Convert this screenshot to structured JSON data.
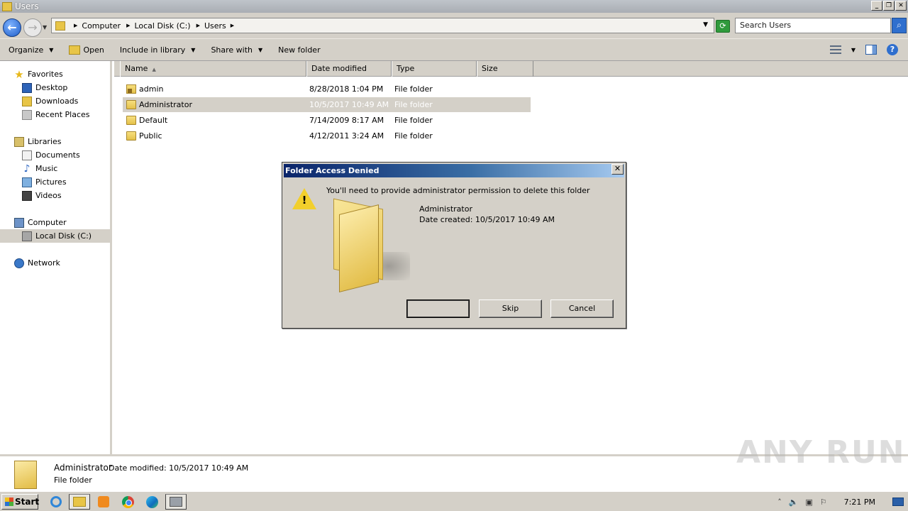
{
  "window": {
    "title": "Users"
  },
  "address": {
    "crumbs": [
      "Computer",
      "Local Disk (C:)",
      "Users"
    ],
    "search_placeholder": "Search Users"
  },
  "toolbar": {
    "organize": "Organize",
    "open": "Open",
    "include": "Include in library",
    "share": "Share with",
    "new_folder": "New folder"
  },
  "nav": {
    "favorites": "Favorites",
    "desktop": "Desktop",
    "downloads": "Downloads",
    "recent": "Recent Places",
    "libraries": "Libraries",
    "documents": "Documents",
    "music": "Music",
    "pictures": "Pictures",
    "videos": "Videos",
    "computer": "Computer",
    "local_disk": "Local Disk (C:)",
    "network": "Network"
  },
  "columns": {
    "name": "Name",
    "date": "Date modified",
    "type": "Type",
    "size": "Size"
  },
  "files": [
    {
      "name": "admin",
      "date": "8/28/2018 1:04 PM",
      "type": "File folder",
      "locked": true
    },
    {
      "name": "Administrator",
      "date": "10/5/2017 10:49 AM",
      "type": "File folder",
      "selected": true
    },
    {
      "name": "Default",
      "date": "7/14/2009 8:17 AM",
      "type": "File folder"
    },
    {
      "name": "Public",
      "date": "4/12/2011 3:24 AM",
      "type": "File folder"
    }
  ],
  "dialog": {
    "title": "Folder Access Denied",
    "close": "✕",
    "message": "You'll need to provide administrator permission to delete this folder",
    "folder_name": "Administrator",
    "date_created": "Date created: 10/5/2017 10:49 AM",
    "continue_label": "",
    "skip_label": "Skip",
    "cancel_label": "Cancel"
  },
  "details": {
    "name": "Administrator",
    "modified": "Date modified: 10/5/2017 10:49 AM",
    "type": "File folder"
  },
  "watermark": "ANY RUN",
  "taskbar": {
    "start": "Start",
    "clock": "7:21 PM"
  }
}
